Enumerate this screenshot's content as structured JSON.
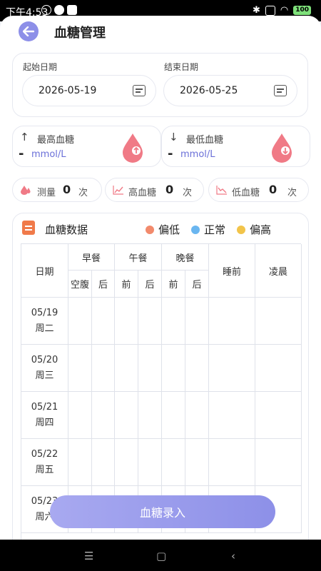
{
  "status_bar": {
    "time": "下午4:53",
    "battery": "100"
  },
  "header": {
    "title": "血糖管理"
  },
  "date_range": {
    "start_label": "起始日期",
    "start_value": "2026-05-19",
    "end_label": "结束日期",
    "end_value": "2026-05-25"
  },
  "summary": {
    "highest": {
      "arrow": "↑",
      "label": "最高血糖",
      "value": "-",
      "unit": "mmol/L"
    },
    "lowest": {
      "arrow": "↓",
      "label": "最低血糖",
      "value": "-",
      "unit": "mmol/L"
    }
  },
  "stats": {
    "measure": {
      "label": "测量",
      "value": "0",
      "unit": "次"
    },
    "high": {
      "label": "高血糖",
      "value": "0",
      "unit": "次"
    },
    "low": {
      "label": "低血糖",
      "value": "0",
      "unit": "次"
    }
  },
  "data_section": {
    "title": "血糖数据",
    "legend": [
      {
        "label": "偏低",
        "color": "#f28a6c"
      },
      {
        "label": "正常",
        "color": "#6ab6f0"
      },
      {
        "label": "偏高",
        "color": "#f2c44a"
      }
    ]
  },
  "table": {
    "date_header": "日期",
    "meals": {
      "breakfast": "早餐",
      "lunch": "午餐",
      "dinner": "晚餐",
      "bedtime": "睡前",
      "early_morning": "凌晨"
    },
    "sub": {
      "fasting": "空腹",
      "after": "后",
      "before": "前"
    },
    "rows": [
      {
        "date": "05/19",
        "weekday": "周二"
      },
      {
        "date": "05/20",
        "weekday": "周三"
      },
      {
        "date": "05/21",
        "weekday": "周四"
      },
      {
        "date": "05/22",
        "weekday": "周五"
      },
      {
        "date": "05/23",
        "weekday": "周六"
      }
    ]
  },
  "actions": {
    "record_button": "血糖录入"
  },
  "colors": {
    "accent": "#8d90e8",
    "drop_red": "#f07a86",
    "unit_text": "#6a6fd8"
  }
}
